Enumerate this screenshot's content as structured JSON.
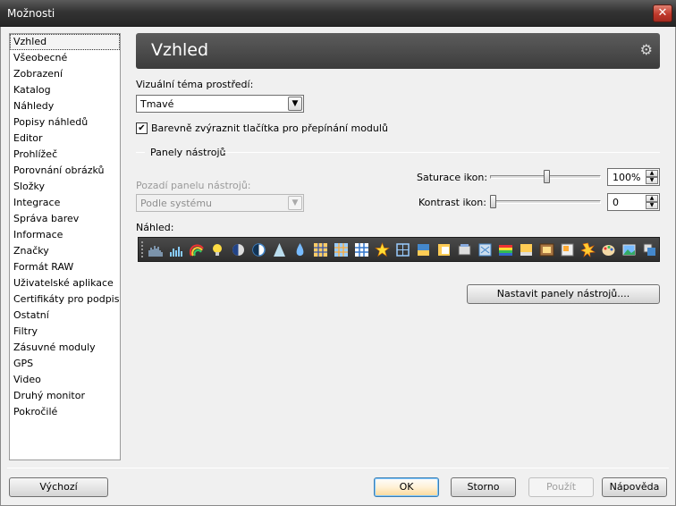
{
  "window": {
    "title": "Možnosti",
    "close_icon": "close-icon"
  },
  "sidebar": {
    "items": [
      "Vzhled",
      "Všeobecné",
      "Zobrazení",
      "Katalog",
      "Náhledy",
      "Popisy náhledů",
      "Editor",
      "Prohlížeč",
      "Porovnání obrázků",
      "Složky",
      "Integrace",
      "Správa barev",
      "Informace",
      "Značky",
      "Formát RAW",
      "Uživatelské aplikace",
      "Certifikáty pro podpis",
      "Ostatní",
      "Filtry",
      "Zásuvné moduly",
      "GPS",
      "Video",
      "Druhý monitor",
      "Pokročilé"
    ],
    "selected": "Vzhled"
  },
  "header": {
    "title": "Vzhled",
    "icon": "gear-icon"
  },
  "theme": {
    "label": "Vizuální téma prostředí:",
    "value": "Tmavé"
  },
  "highlight_checkbox": {
    "label": "Barevně zvýraznit tlačítka pro přepínání modulů",
    "checked": true
  },
  "toolbars": {
    "section_title": "Panely nástrojů",
    "bg_label": "Pozadí panelu nástrojů:",
    "bg_value": "Podle systému",
    "saturation_label": "Saturace ikon:",
    "saturation_value": "100%",
    "contrast_label": "Kontrast ikon:",
    "contrast_value": "0",
    "preview_label": "Náhled:",
    "configure_button": "Nastavit panely nástrojů...."
  },
  "toolbar_icons": [
    "histogram-icon",
    "levels-icon",
    "rainbow-icon",
    "bulb-icon",
    "dark-bulb-icon",
    "contrast-circle-icon",
    "triangle-icon",
    "droplet-icon",
    "grid-icon",
    "grid-alt-icon",
    "grid-blue-icon",
    "star-icon",
    "frame-icon",
    "image-icon",
    "image-alt-icon",
    "stack-icon",
    "film-icon",
    "flag-icon",
    "palette-icon",
    "film-strip-icon",
    "page-icon",
    "burst-icon",
    "paint-palette-icon",
    "picture-icon",
    "resize-icon"
  ],
  "footer": {
    "default_button": "Výchozí",
    "ok_button": "OK",
    "cancel_button": "Storno",
    "apply_button": "Použít",
    "help_button": "Nápověda"
  }
}
